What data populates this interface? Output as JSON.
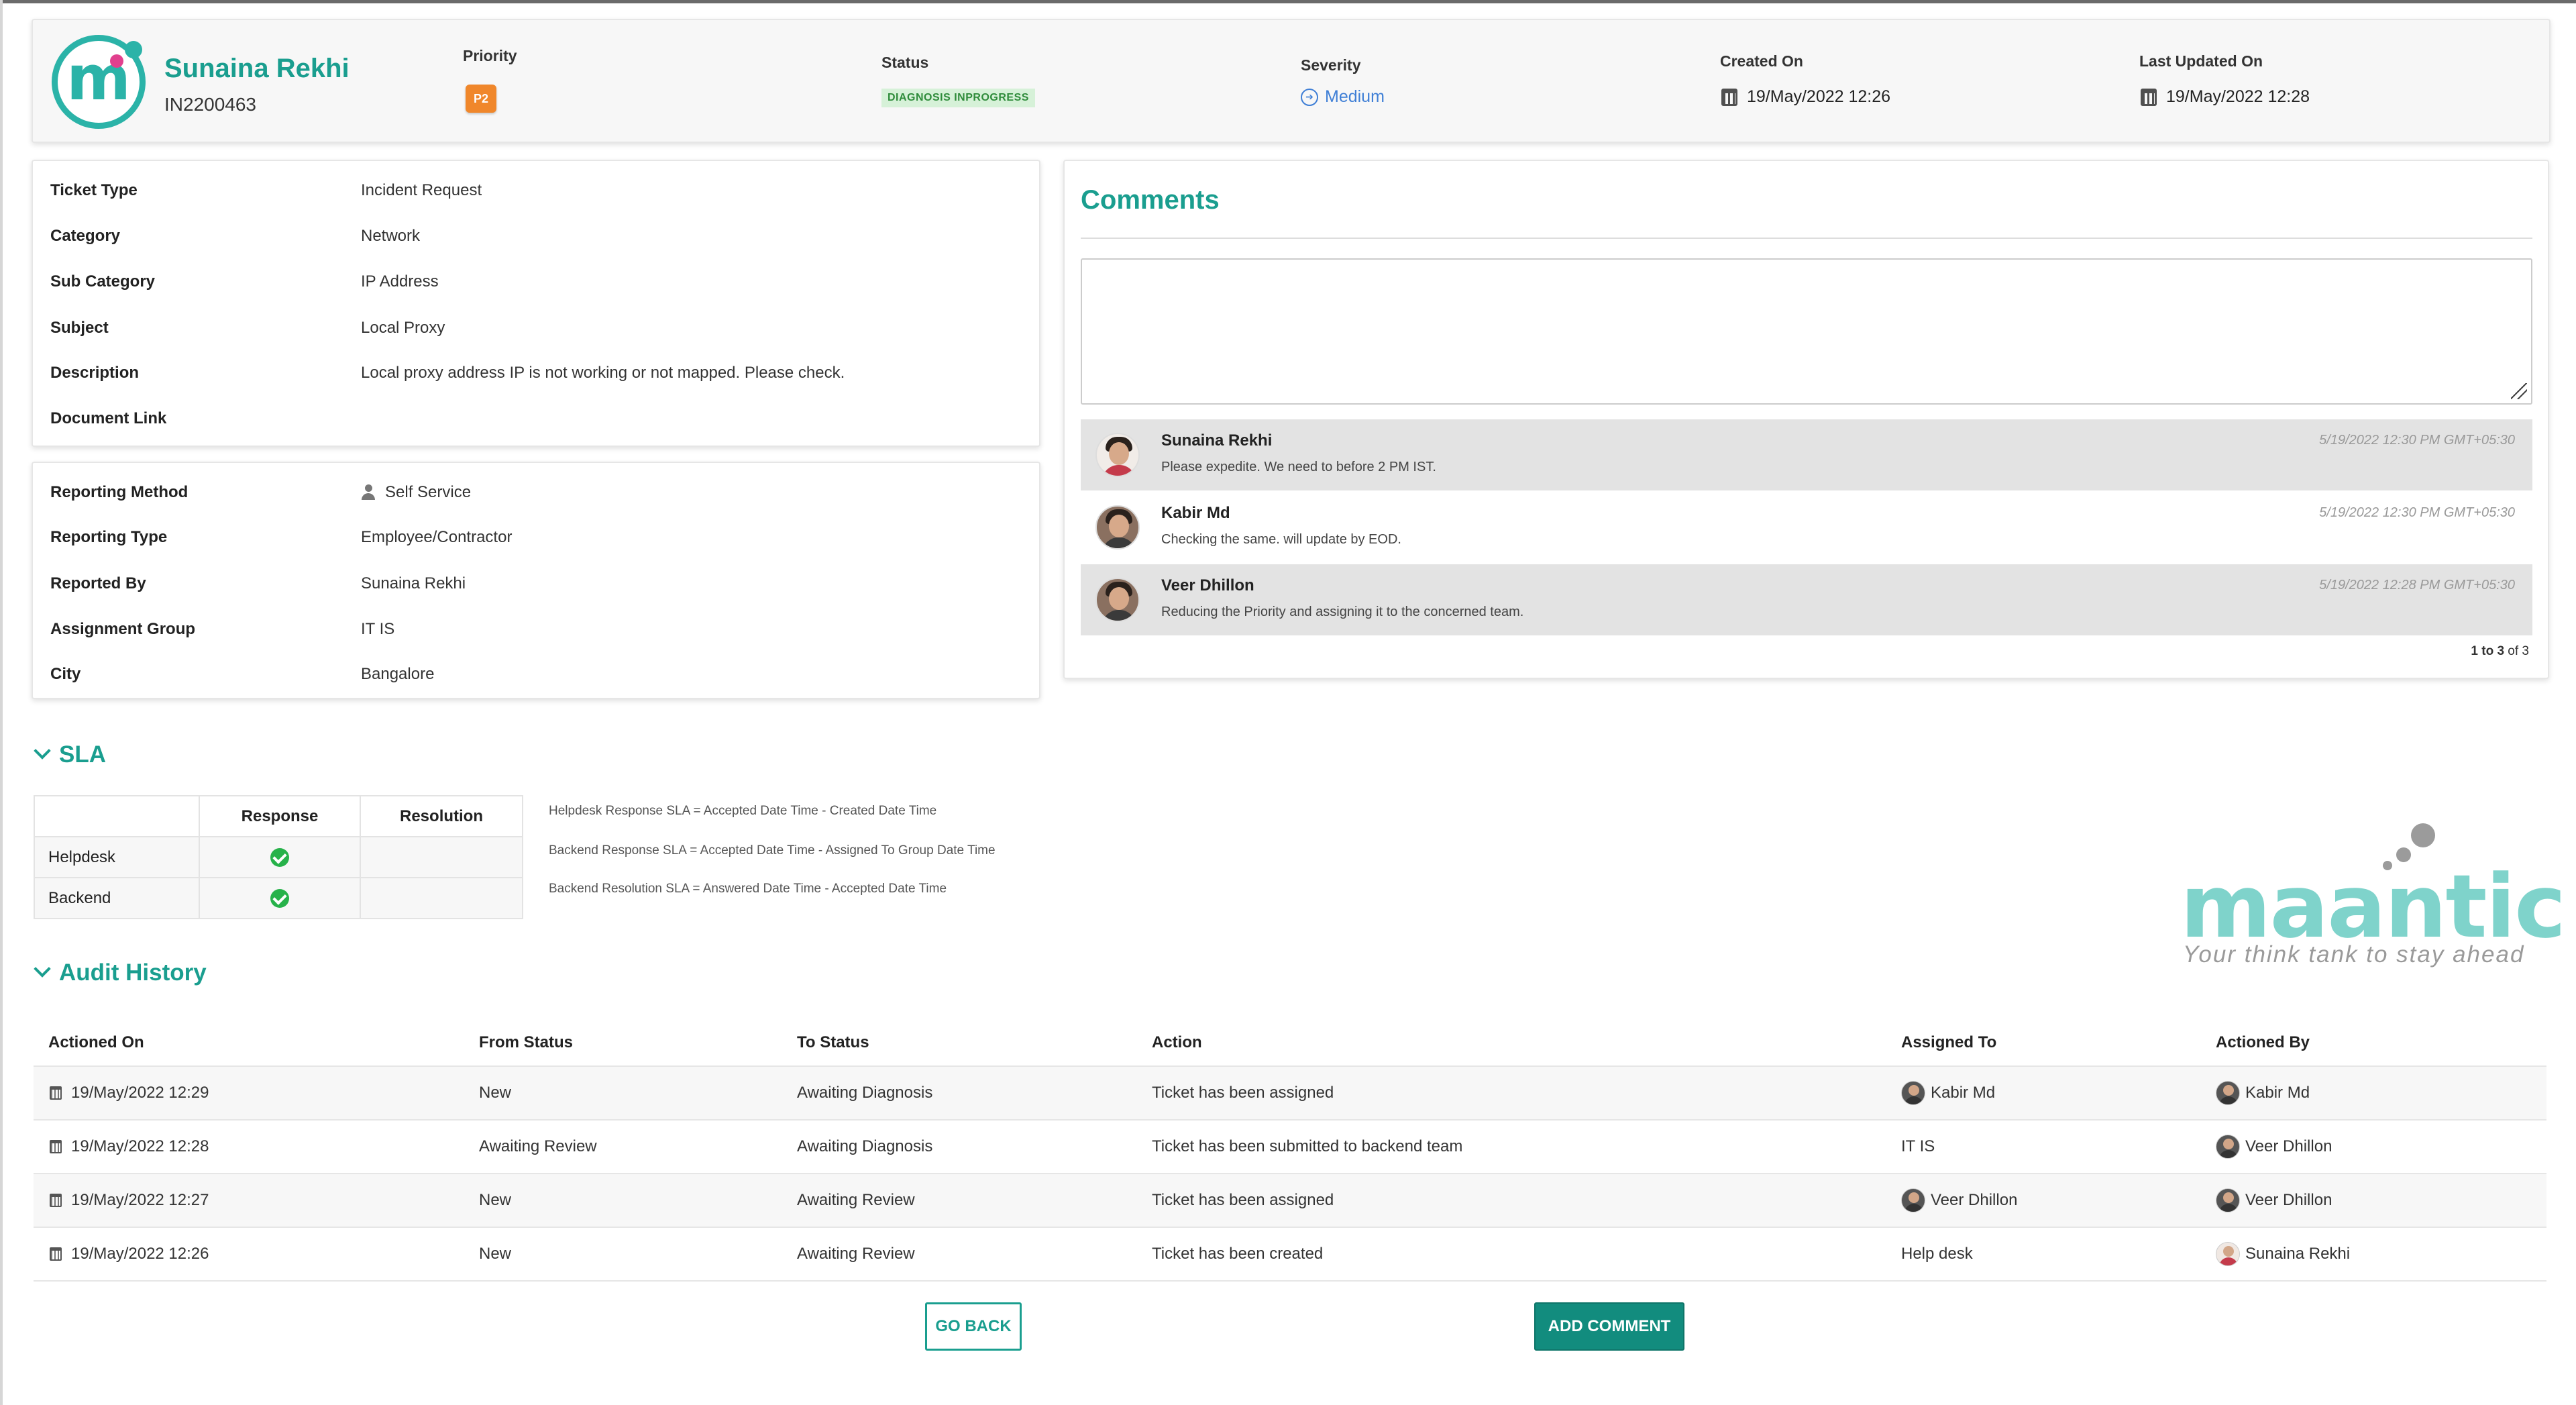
{
  "header": {
    "user_name": "Sunaina Rekhi",
    "ticket_id": "IN2200463",
    "priority_label": "Priority",
    "priority_value": "P2",
    "status_label": "Status",
    "status_value": "DIAGNOSIS INPROGRESS",
    "severity_label": "Severity",
    "severity_value": "Medium",
    "created_label": "Created On",
    "created_value": "19/May/2022 12:26",
    "updated_label": "Last Updated On",
    "updated_value": "19/May/2022 12:28",
    "colors": {
      "accent": "#1a9e8f",
      "priority": "#f0872b",
      "severity": "#3f7fd6"
    }
  },
  "details": [
    {
      "key": "Ticket Type",
      "value": "Incident Request"
    },
    {
      "key": "Category",
      "value": "Network"
    },
    {
      "key": "Sub Category",
      "value": "IP Address"
    },
    {
      "key": "Subject",
      "value": "Local Proxy"
    },
    {
      "key": "Description",
      "value": "Local proxy address IP is not working or not mapped. Please check."
    },
    {
      "key": "Document Link",
      "value": ""
    }
  ],
  "reporting": [
    {
      "key": "Reporting Method",
      "value": "Self Service",
      "icon": "person-icon"
    },
    {
      "key": "Reporting Type",
      "value": "Employee/Contractor"
    },
    {
      "key": "Reported By",
      "value": "Sunaina Rekhi"
    },
    {
      "key": "Assignment Group",
      "value": "IT IS"
    },
    {
      "key": "City",
      "value": "Bangalore"
    }
  ],
  "comments": {
    "title": "Comments",
    "input_value": "",
    "items": [
      {
        "name": "Sunaina Rekhi",
        "text": "Please expedite. We need to before 2 PM IST.",
        "time": "5/19/2022 12:30 PM GMT+05:30"
      },
      {
        "name": "Kabir Md",
        "text": "Checking the same. will update by EOD.",
        "time": "5/19/2022 12:30 PM GMT+05:30"
      },
      {
        "name": "Veer Dhillon",
        "text": "Reducing the Priority and assigning it to the concerned team.",
        "time": "5/19/2022 12:28 PM GMT+05:30"
      }
    ],
    "pager_range": "1 to 3",
    "pager_of": "of 3"
  },
  "sla": {
    "title": "SLA",
    "col_response": "Response",
    "col_resolution": "Resolution",
    "rows": [
      {
        "label": "Helpdesk",
        "response": "check"
      },
      {
        "label": "Backend",
        "response": "check"
      }
    ],
    "notes": [
      "Helpdesk  Response SLA = Accepted Date Time - Created Date Time",
      "Backend Response SLA = Accepted Date Time - Assigned To Group Date Time",
      "Backend Resolution SLA = Answered Date Time - Accepted Date Time"
    ]
  },
  "brand": {
    "word": "maantic",
    "tagline": "Your think tank to stay ahead"
  },
  "audit": {
    "title": "Audit History",
    "columns": [
      "Actioned On",
      "From Status",
      "To Status",
      "Action",
      "Assigned To",
      "Actioned By"
    ],
    "rows": [
      {
        "on": "19/May/2022 12:29",
        "from": "New",
        "to": "Awaiting Diagnosis",
        "action": "Ticket has been assigned",
        "assigned": "Kabir Md",
        "by": "Kabir Md"
      },
      {
        "on": "19/May/2022 12:28",
        "from": "Awaiting Review",
        "to": "Awaiting Diagnosis",
        "action": "Ticket has been submitted to backend team",
        "assigned": "IT IS",
        "by": "Veer Dhillon"
      },
      {
        "on": "19/May/2022 12:27",
        "from": "New",
        "to": "Awaiting Review",
        "action": "Ticket has been assigned",
        "assigned": "Veer Dhillon",
        "by": "Veer Dhillon"
      },
      {
        "on": "19/May/2022 12:26",
        "from": "New",
        "to": "Awaiting Review",
        "action": "Ticket has been created",
        "assigned": "Help desk",
        "by": "Sunaina Rekhi"
      }
    ]
  },
  "buttons": {
    "back": "GO BACK",
    "add_comment": "ADD COMMENT"
  }
}
